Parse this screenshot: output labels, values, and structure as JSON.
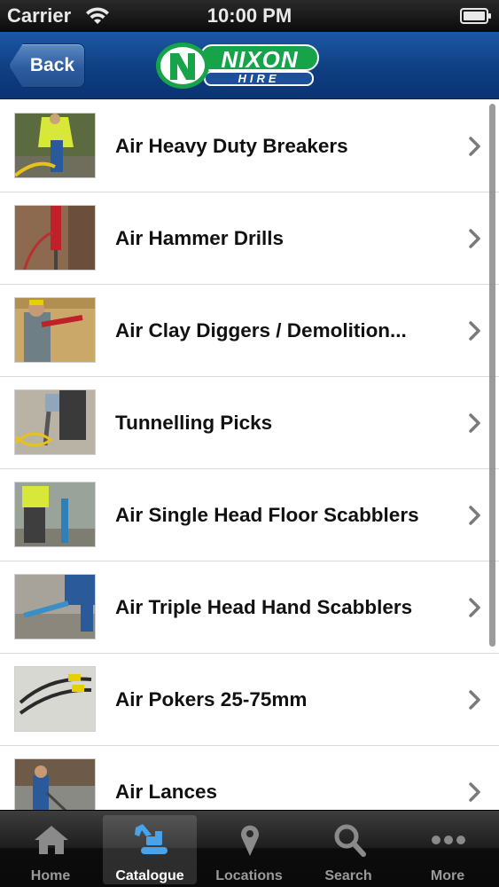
{
  "status_bar": {
    "carrier": "Carrier",
    "time": "10:00 PM"
  },
  "nav": {
    "back_label": "Back",
    "logo_word": "NIXON",
    "logo_sub": "HIRE"
  },
  "list": {
    "items": [
      {
        "label": "Air Heavy Duty Breakers"
      },
      {
        "label": "Air Hammer Drills"
      },
      {
        "label": "Air Clay Diggers / Demolition..."
      },
      {
        "label": "Tunnelling Picks"
      },
      {
        "label": "Air Single Head Floor Scabblers"
      },
      {
        "label": "Air Triple Head Hand Scabblers"
      },
      {
        "label": "Air Pokers 25-75mm"
      },
      {
        "label": "Air Lances"
      }
    ]
  },
  "tabs": [
    {
      "label": "Home",
      "icon": "home-icon"
    },
    {
      "label": "Catalogue",
      "icon": "excavator-icon",
      "active": true
    },
    {
      "label": "Locations",
      "icon": "map-pin-icon"
    },
    {
      "label": "Search",
      "icon": "search-icon"
    },
    {
      "label": "More",
      "icon": "more-dots-icon"
    }
  ],
  "colors": {
    "brand_blue": "#0f3f82",
    "brand_green": "#16a34a",
    "tab_active_icon": "#4aa3e8"
  }
}
